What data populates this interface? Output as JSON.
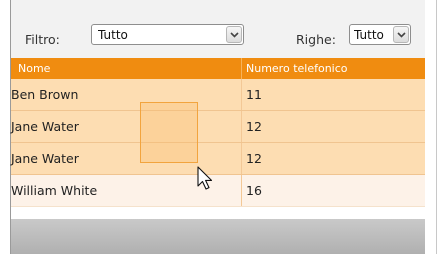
{
  "toolbar": {
    "filter_label": "Filtro:",
    "filter_value": "Tutto",
    "rows_label": "Righe:",
    "rows_value": "Tutto"
  },
  "table": {
    "columns": [
      "Nome",
      "Numero telefonico"
    ],
    "rows": [
      {
        "name": "Ben Brown",
        "phone": "11"
      },
      {
        "name": "Jane Water",
        "phone": "12"
      },
      {
        "name": "Jane Water",
        "phone": "12"
      },
      {
        "name": "William White",
        "phone": "16"
      }
    ]
  },
  "colors": {
    "header": "#f08c10",
    "highlight_row": "#fdddb2",
    "plain_row": "#fdf2e8",
    "footer": "#bdbdbd"
  },
  "icons": [
    "chevron-down-icon",
    "mouse-pointer-icon"
  ]
}
